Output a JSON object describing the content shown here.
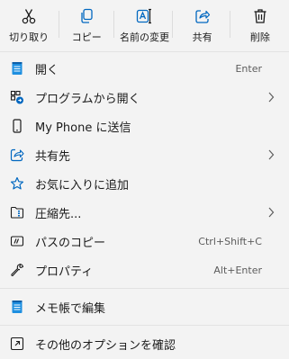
{
  "toolbar": {
    "cut_label": "切り取り",
    "copy_label": "コピー",
    "rename_label": "名前の変更",
    "share_label": "共有",
    "delete_label": "削除"
  },
  "items": [
    {
      "label": "開く",
      "shortcut": "Enter",
      "icon": "notepad-icon"
    },
    {
      "label": "プログラムから開く",
      "icon": "open-with-icon",
      "submenu": true
    },
    {
      "label": "My Phone に送信",
      "icon": "phone-icon"
    },
    {
      "label": "共有先",
      "icon": "share-icon",
      "submenu": true
    },
    {
      "label": "お気に入りに追加",
      "icon": "star-icon"
    },
    {
      "label": "圧縮先...",
      "icon": "zip-folder-icon",
      "submenu": true
    },
    {
      "label": "パスのコピー",
      "shortcut": "Ctrl+Shift+C",
      "icon": "copy-path-icon"
    },
    {
      "label": "プロパティ",
      "shortcut": "Alt+Enter",
      "icon": "wrench-icon"
    },
    {
      "label": "メモ帳で編集",
      "icon": "notepad-icon"
    },
    {
      "label": "その他のオプションを確認",
      "icon": "more-options-icon"
    }
  ],
  "colors": {
    "accent": "#0067c0",
    "background": "#f3f3f3",
    "text": "#1b1b1b",
    "shortcut": "#5c5c5c"
  }
}
